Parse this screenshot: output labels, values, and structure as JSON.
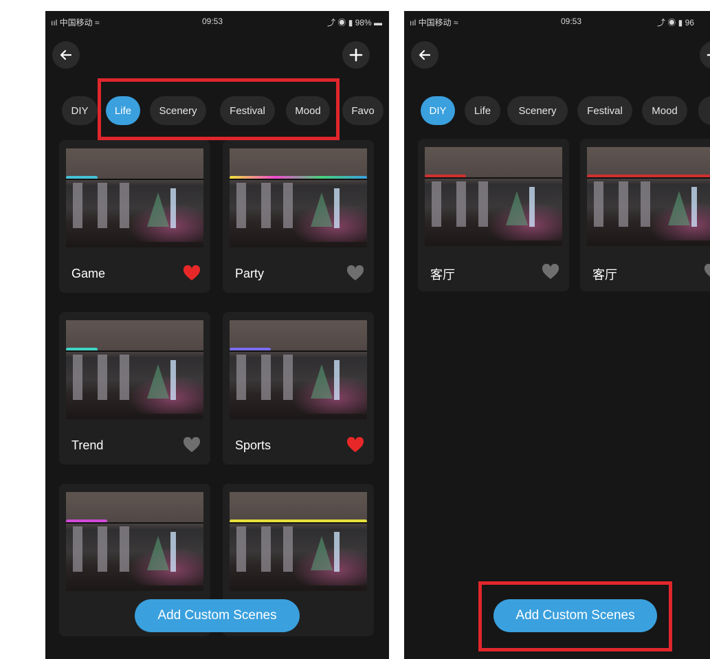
{
  "colors": {
    "background": "#161616",
    "accent": "#3aa0de",
    "highlight": "#e0262c",
    "favorite_on": "#e82828",
    "favorite_off": "#6f6f6f"
  },
  "left": {
    "status": {
      "carrier": "ııl 中国移动 ≈",
      "time": "09:53",
      "indicators": "⤴ ◉ ▮ 98% ▬"
    },
    "back_icon": "arrow-left-icon",
    "add_icon": "plus-icon",
    "tabs": [
      {
        "label": "DIY",
        "active": false
      },
      {
        "label": "Life",
        "active": true
      },
      {
        "label": "Scenery",
        "active": false
      },
      {
        "label": "Festival",
        "active": false
      },
      {
        "label": "Mood",
        "active": false
      },
      {
        "label": "Favo",
        "active": false
      }
    ],
    "cards": [
      {
        "label": "Game",
        "favorite": true,
        "led": "#45c1d6"
      },
      {
        "label": "Party",
        "favorite": false,
        "led": "linear-gradient(90deg,#f0e13a,#f04ad0,#48d07a,#3aa0de)"
      },
      {
        "label": "Trend",
        "favorite": false,
        "led": "#3fd3c4"
      },
      {
        "label": "Sports",
        "favorite": true,
        "led": "#7a6cf0"
      },
      {
        "label": "",
        "favorite": false,
        "led": "#d04ad8"
      },
      {
        "label": "",
        "favorite": false,
        "led": "#e6e03a"
      }
    ],
    "cta_label": "Add Custom Scenes"
  },
  "right": {
    "status": {
      "carrier": "ııl 中国移动 ≈",
      "time": "09:53",
      "indicators": "⤴ ◉ ▮ 96"
    },
    "back_icon": "arrow-left-icon",
    "add_icon": "plus-icon",
    "tabs": [
      {
        "label": "DIY",
        "active": true
      },
      {
        "label": "Life",
        "active": false
      },
      {
        "label": "Scenery",
        "active": false
      },
      {
        "label": "Festival",
        "active": false
      },
      {
        "label": "Mood",
        "active": false
      },
      {
        "label": "",
        "active": false
      }
    ],
    "cards": [
      {
        "label": "客厅",
        "favorite": false,
        "led": "#d03030"
      },
      {
        "label": "客厅",
        "favorite": false,
        "led": "#d03030"
      }
    ],
    "cta_label": "Add Custom Scenes"
  }
}
